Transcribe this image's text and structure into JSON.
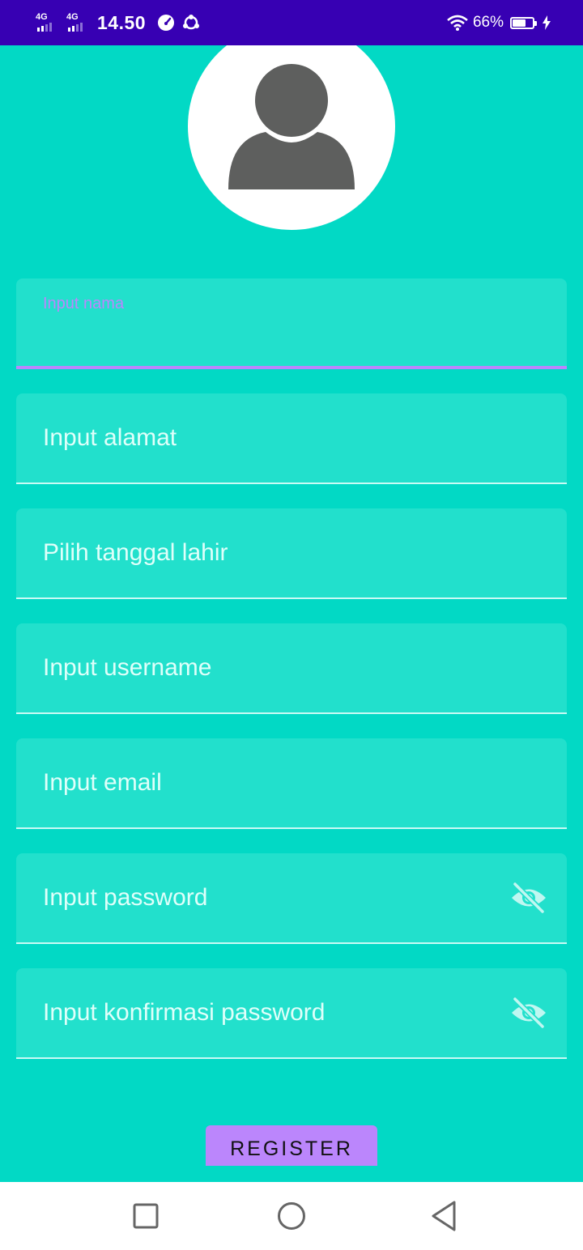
{
  "status_bar": {
    "network_1": "4G",
    "network_2": "4G",
    "time": "14.50",
    "battery_percent": "66%",
    "battery_level": 0.66
  },
  "form": {
    "nama": {
      "label": "Input nama",
      "value": ""
    },
    "alamat": {
      "hint": "Input alamat"
    },
    "tanggal_lahir": {
      "hint": "Pilih tanggal lahir"
    },
    "username": {
      "hint": "Input username"
    },
    "email": {
      "hint": "Input email"
    },
    "password": {
      "hint": "Input password",
      "toggle_icon": "eye-off-icon"
    },
    "konfirmasi_password": {
      "hint": "Input konfirmasi password",
      "toggle_icon": "eye-off-icon"
    }
  },
  "register_button": {
    "label": "REGISTER"
  },
  "colors": {
    "status_bar": "#3700B3",
    "background": "#02D9C5",
    "field_fill": "#22E0CC",
    "accent": "#BB86FC",
    "avatar_gray": "#5E5F5E"
  },
  "navigation": {
    "recents_icon": "square-icon",
    "home_icon": "circle-icon",
    "back_icon": "triangle-back-icon"
  }
}
